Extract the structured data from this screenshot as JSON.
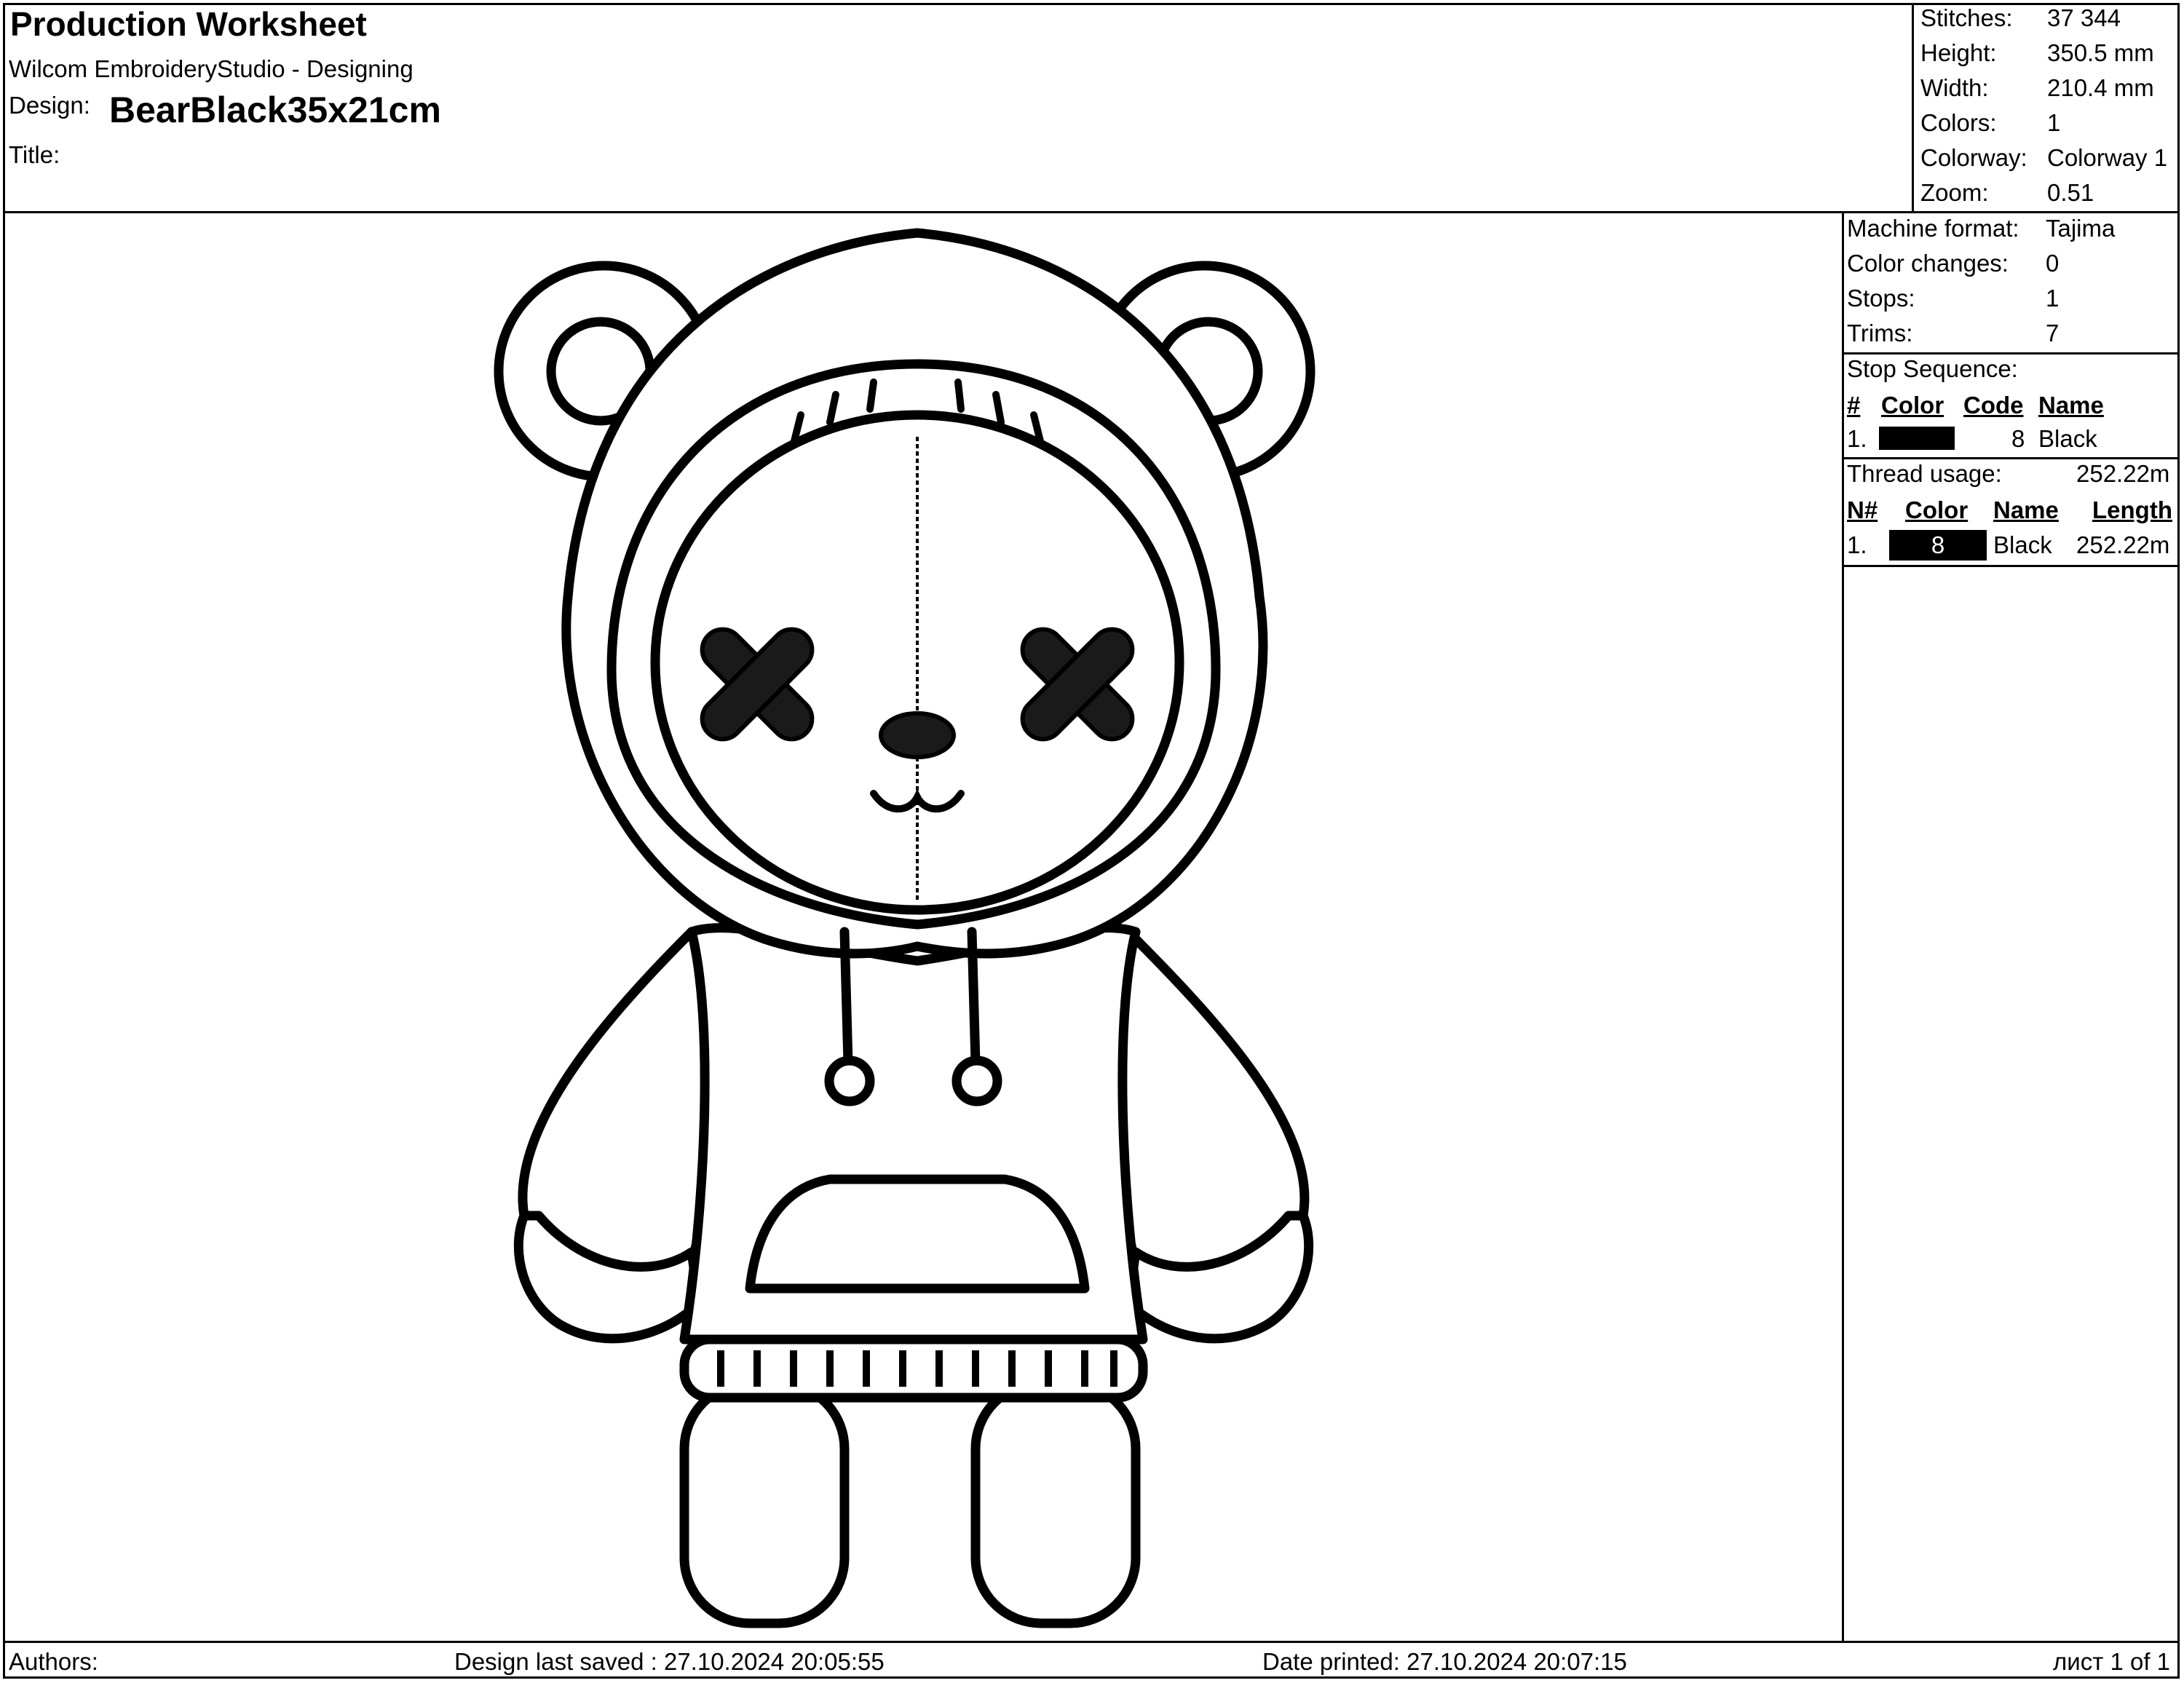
{
  "header": {
    "title": "Production Worksheet",
    "app": "Wilcom EmbroideryStudio - Designing",
    "design_label": "Design:",
    "design_name": "BearBlack35x21cm",
    "title_label": "Title:"
  },
  "summary": [
    {
      "label": "Stitches:",
      "value": "37 344"
    },
    {
      "label": "Height:",
      "value": "350.5 mm"
    },
    {
      "label": "Width:",
      "value": "210.4 mm"
    },
    {
      "label": "Colors:",
      "value": "1"
    },
    {
      "label": "Colorway:",
      "value": "Colorway 1"
    },
    {
      "label": "Zoom:",
      "value": "0.51"
    }
  ],
  "machine": [
    {
      "label": "Machine format:",
      "value": "Tajima"
    },
    {
      "label": "Color changes:",
      "value": "0"
    },
    {
      "label": "Stops:",
      "value": "1"
    },
    {
      "label": "Trims:",
      "value": "7"
    }
  ],
  "stop_sequence": {
    "label": "Stop Sequence:",
    "headers": [
      "#",
      "Color",
      "Code",
      "Name"
    ],
    "rows": [
      {
        "num": "1.",
        "color": "#000000",
        "code": "8",
        "name": "Black"
      }
    ]
  },
  "thread_usage": {
    "label": "Thread usage:",
    "total": "252.22m",
    "headers": [
      "N#",
      "Color",
      "Name",
      "Length"
    ],
    "rows": [
      {
        "num": "1.",
        "color": "#000000",
        "code": "8",
        "name": "Black",
        "length": "252.22m"
      }
    ]
  },
  "footer": {
    "authors": "Authors:",
    "saved": "Design last saved : 27.10.2024 20:05:55",
    "printed": "Date printed: 27.10.2024 20:07:15",
    "page": "лист 1 of 1"
  }
}
